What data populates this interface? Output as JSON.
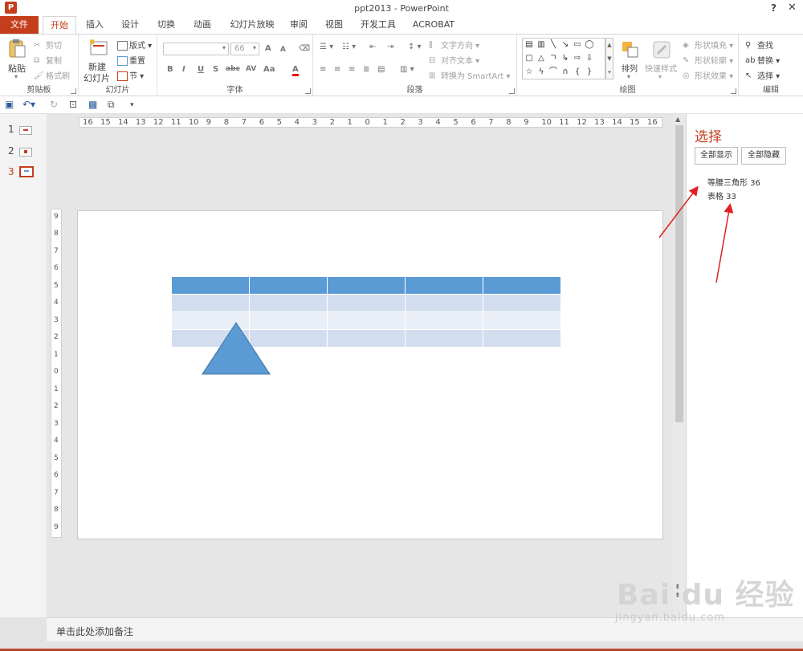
{
  "window": {
    "app_icon": "P",
    "title": "ppt2013 - PowerPoint",
    "help": "?",
    "close": "✕"
  },
  "tabs": [
    {
      "label": "文件"
    },
    {
      "label": "开始"
    },
    {
      "label": "插入"
    },
    {
      "label": "设计"
    },
    {
      "label": "切换"
    },
    {
      "label": "动画"
    },
    {
      "label": "幻灯片放映"
    },
    {
      "label": "审阅"
    },
    {
      "label": "视图"
    },
    {
      "label": "开发工具"
    },
    {
      "label": "ACROBAT"
    }
  ],
  "ribbon": {
    "clipboard": {
      "label": "剪贴板",
      "paste": "粘贴",
      "cut": "剪切",
      "copy": "复制",
      "format_painter": "格式刷"
    },
    "slides": {
      "label": "幻灯片",
      "new_slide_1": "新建",
      "new_slide_2": "幻灯片",
      "layout": "版式",
      "reset": "重置",
      "section": "节"
    },
    "font": {
      "label": "字体",
      "font_size": "66",
      "grow": "A",
      "shrink": "A",
      "bold": "B",
      "italic": "I",
      "underline": "U",
      "shadow": "S",
      "strike": "abc",
      "spacing": "AV",
      "case": "Aa",
      "color": "A"
    },
    "paragraph": {
      "label": "段落",
      "text_direction": "文字方向",
      "align_text": "对齐文本",
      "smartart": "转换为 SmartArt"
    },
    "drawing": {
      "label": "绘图",
      "arrange": "排列",
      "quick_styles": "快速样式",
      "shape_fill": "形状填充",
      "shape_outline": "形状轮廓",
      "shape_effects": "形状效果"
    },
    "editing": {
      "label": "编辑",
      "find": "查找",
      "replace": "替换",
      "select": "选择"
    }
  },
  "thumbnails": [
    {
      "num": "1"
    },
    {
      "num": "2"
    },
    {
      "num": "3"
    }
  ],
  "hruler": [
    "16",
    "15",
    "14",
    "13",
    "12",
    "11",
    "10",
    "9",
    "8",
    "7",
    "6",
    "5",
    "4",
    "3",
    "2",
    "1",
    "0",
    "1",
    "2",
    "3",
    "4",
    "5",
    "6",
    "7",
    "8",
    "9",
    "10",
    "11",
    "12",
    "13",
    "14",
    "15",
    "16"
  ],
  "vruler": [
    "9",
    "8",
    "7",
    "6",
    "5",
    "4",
    "3",
    "2",
    "1",
    "0",
    "1",
    "2",
    "3",
    "4",
    "5",
    "6",
    "7",
    "8",
    "9"
  ],
  "selection_pane": {
    "title": "选择",
    "show_all": "全部显示",
    "hide_all": "全部隐藏",
    "items": [
      {
        "label": "等腰三角形 36"
      },
      {
        "label": "表格 33"
      }
    ]
  },
  "notes": {
    "placeholder": "单击此处添加备注"
  },
  "colors": {
    "accent": "#c43e1c",
    "table_header": "#5b9bd5",
    "table_band_1": "#d2deef",
    "table_band_2": "#eaeff7",
    "triangle_fill": "#5b9bd5",
    "triangle_stroke": "#41719c",
    "arrow": "#e02020"
  },
  "watermark": {
    "brand": "Bai du 经验",
    "url": "jingyan.baidu.com"
  }
}
